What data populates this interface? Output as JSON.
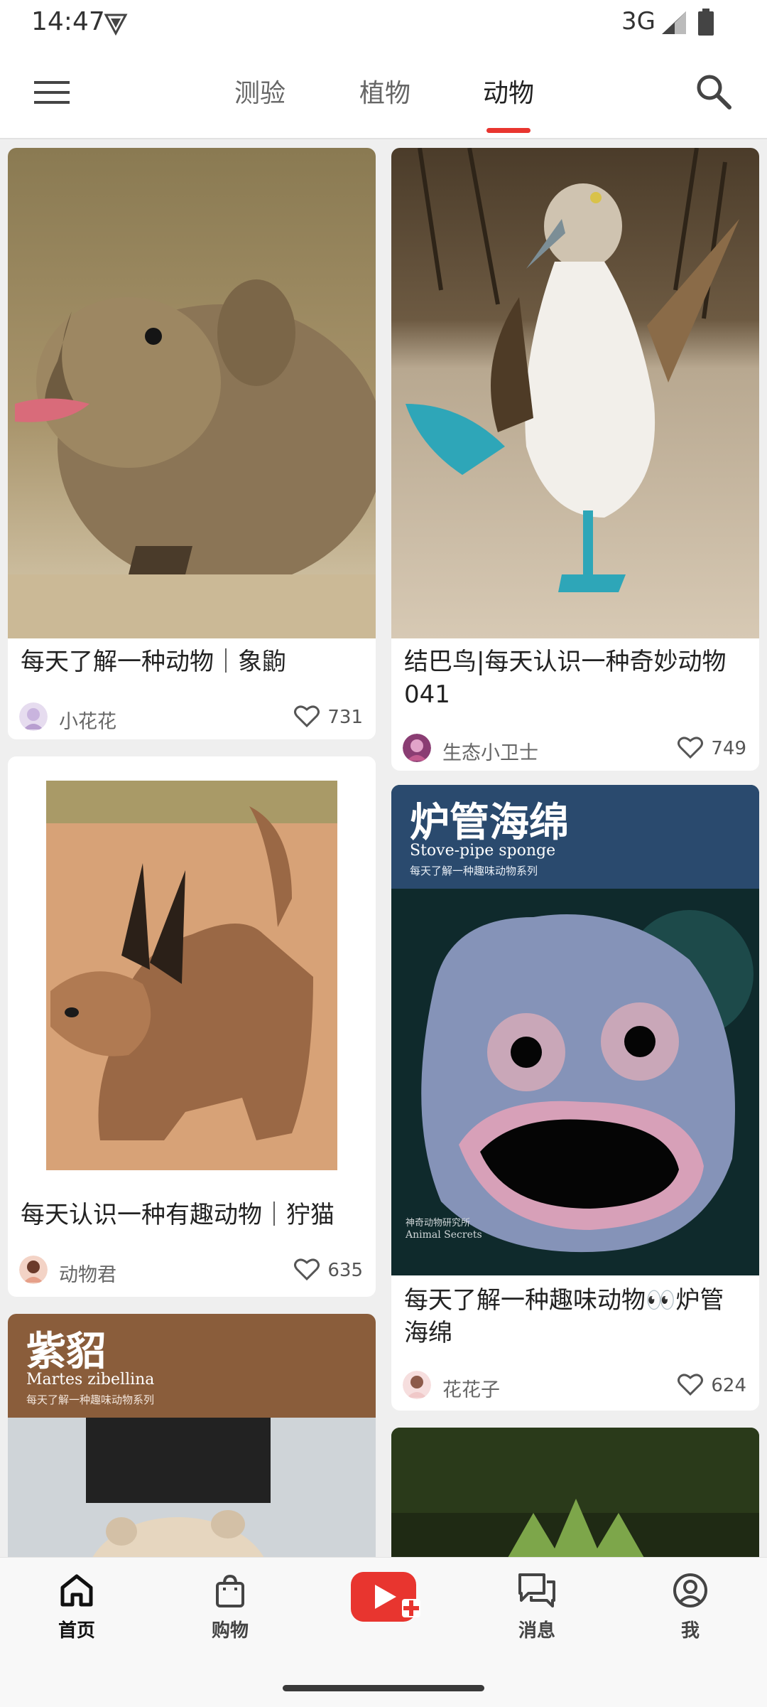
{
  "status_bar": {
    "time": "14:47",
    "network": "3G"
  },
  "tabs": [
    {
      "label": "测验"
    },
    {
      "label": "植物"
    },
    {
      "label": "动物"
    }
  ],
  "active_tab": "动物",
  "accent_color": "#e8352f",
  "cards": [
    {
      "title": "每天了解一种动物｜象鼩",
      "author": "小花花",
      "likes": "731",
      "avatar_color": "#d9c7e8"
    },
    {
      "title": "结巴鸟|每天认识一种奇妙动物041",
      "author": "生态小卫士",
      "likes": "749",
      "avatar_color": "#c25b8f"
    },
    {
      "title": "每天认识一种有趣动物｜狞猫",
      "author": "动物君",
      "likes": "635",
      "avatar_color": "#e6a089"
    },
    {
      "title": "每天了解一种趣味动物👀炉管海绵",
      "author": "花花子",
      "likes": "624",
      "avatar_color": "#f0c8c8",
      "image_text": {
        "cn_title": "炉管海绵",
        "en_title": "Stove-pipe sponge",
        "series": "每天了解一种趣味动物系列",
        "credit_cn": "神奇动物研究所",
        "credit_en": "Animal Secrets"
      }
    },
    {
      "image_text": {
        "cn_title": "紫貂",
        "en_title": "Martes zibellina",
        "series": "每天了解一种趣味动物系列"
      }
    }
  ],
  "bottom_nav": [
    {
      "label": "首页",
      "icon": "home-icon"
    },
    {
      "label": "购物",
      "icon": "shopping-bag-icon"
    },
    {
      "label": "",
      "icon": "create-video-icon"
    },
    {
      "label": "消息",
      "icon": "messages-icon"
    },
    {
      "label": "我",
      "icon": "profile-icon"
    }
  ]
}
